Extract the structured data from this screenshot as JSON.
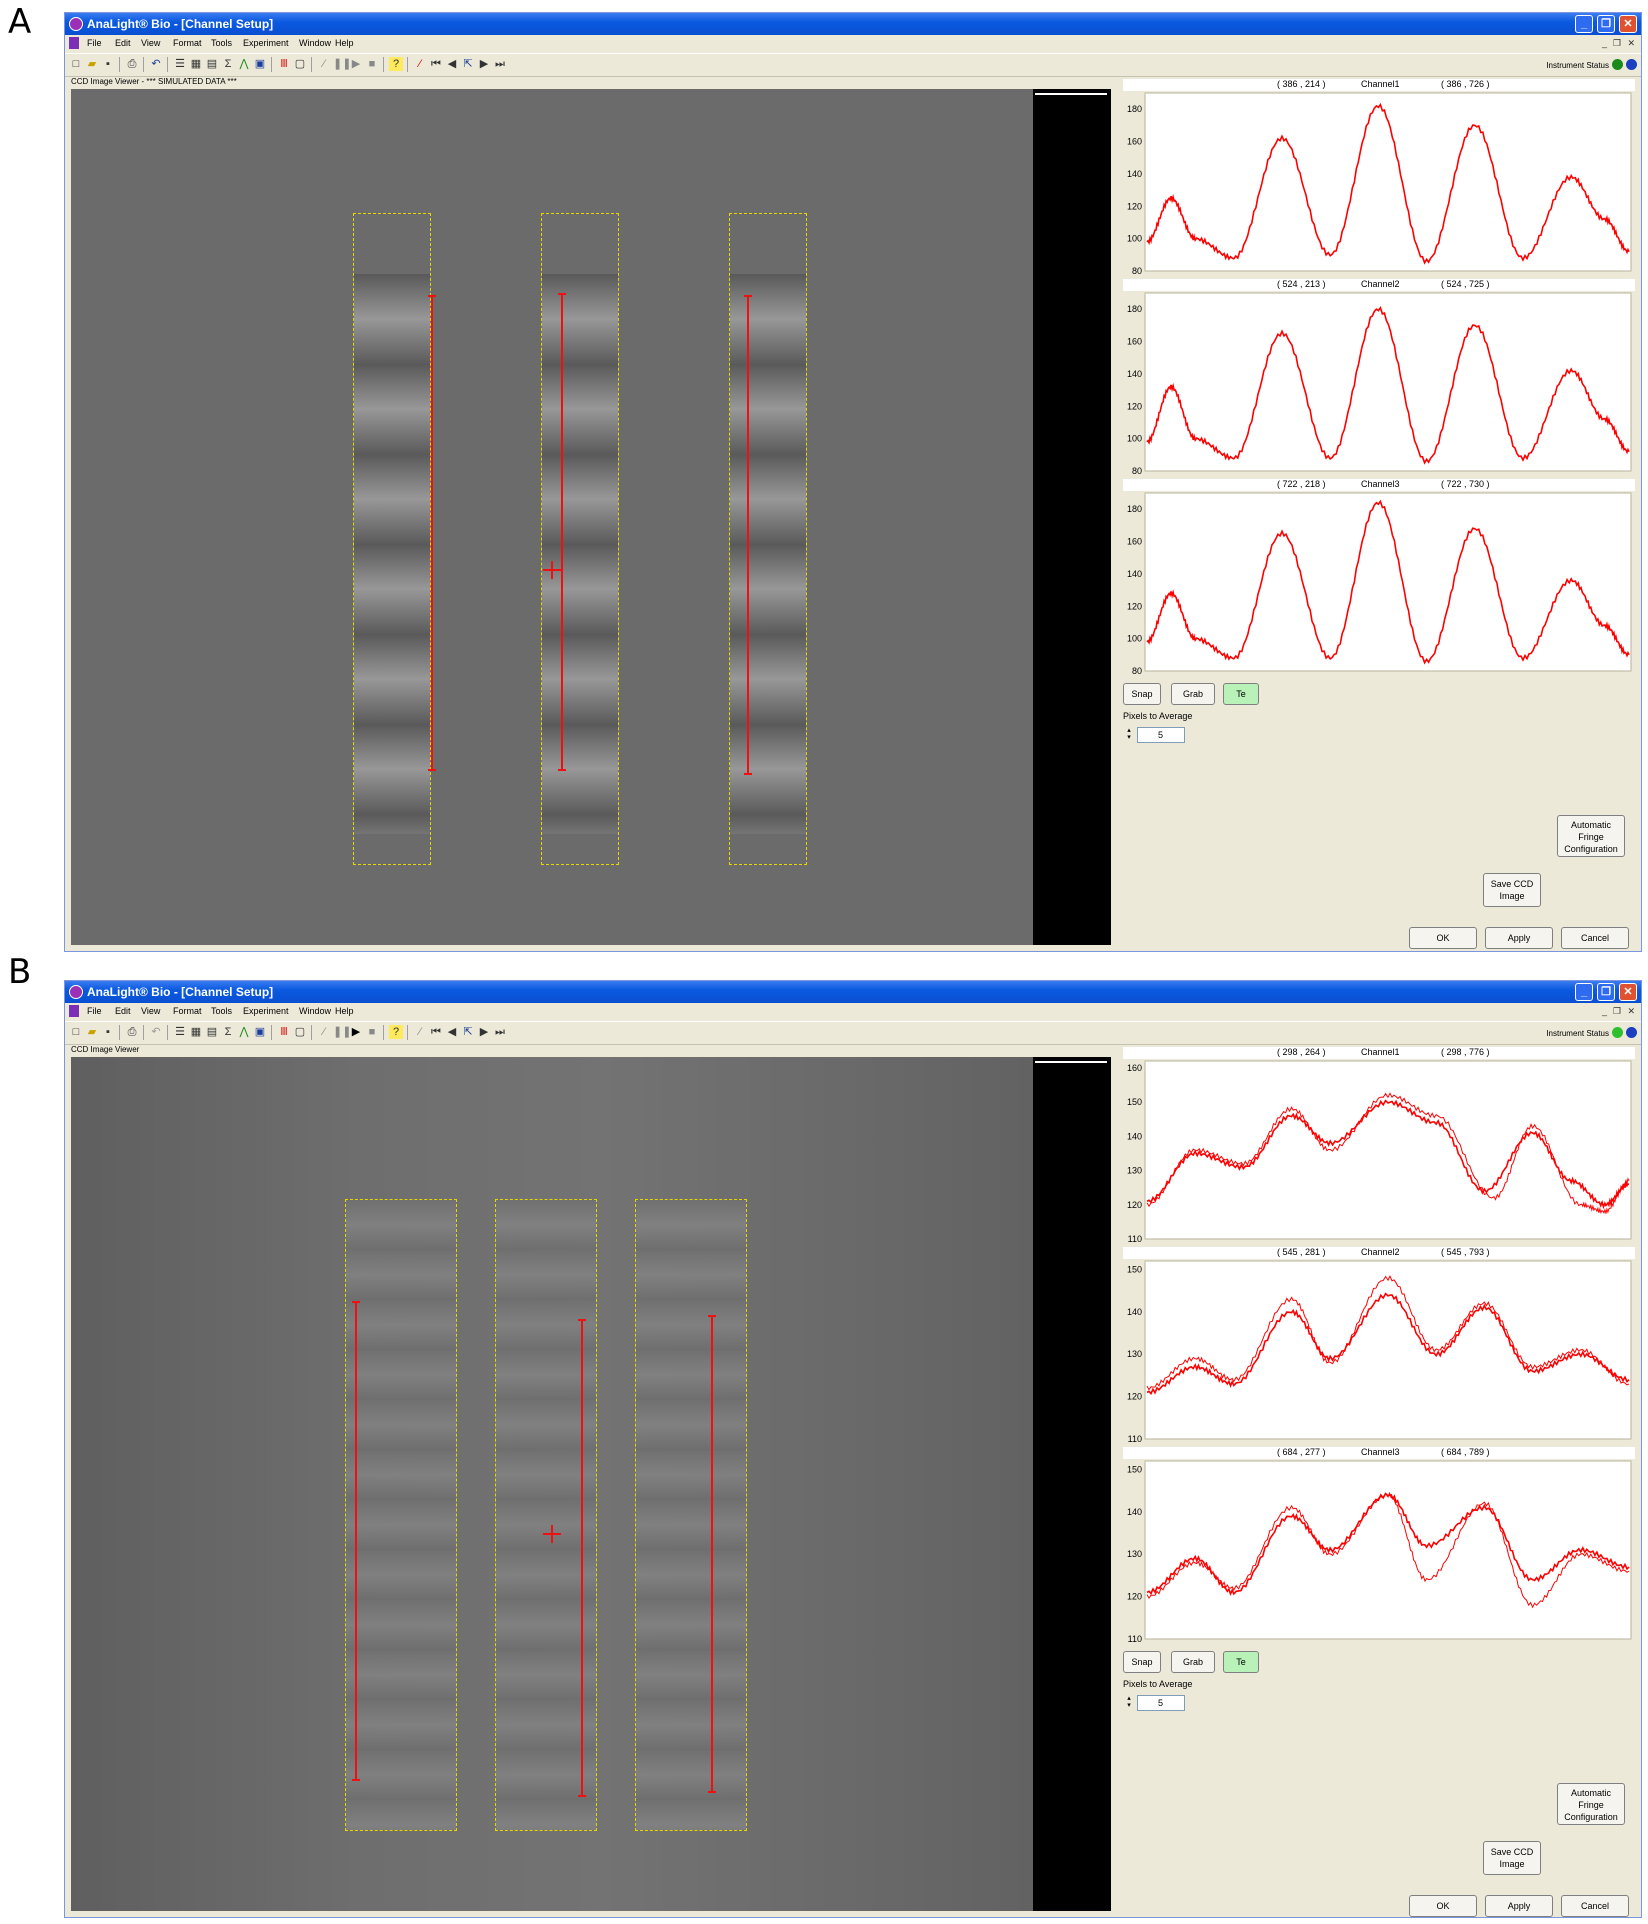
{
  "panels": [
    {
      "letter": "A",
      "window": {
        "title": "AnaLight® Bio - [Channel Setup]",
        "menu": [
          "File",
          "Edit",
          "View",
          "Format",
          "Tools",
          "Experiment",
          "Window",
          "Help"
        ],
        "instrument_status_label": "Instrument Status",
        "viewer_label": "CCD Image Viewer - *** SIMULATED DATA ***"
      },
      "channels": [
        {
          "name": "Channel1",
          "left_coord": "( 386 , 214 )",
          "right_coord": "( 386 , 726 )"
        },
        {
          "name": "Channel2",
          "left_coord": "( 524 , 213 )",
          "right_coord": "( 524 , 725 )"
        },
        {
          "name": "Channel3",
          "left_coord": "( 722 , 218 )",
          "right_coord": "( 722 , 730 )"
        }
      ],
      "buttons": {
        "snap": "Snap",
        "grab": "Grab",
        "te": "Te",
        "auto_fringe": "Automatic Fringe Configuration",
        "save_ccd": "Save CCD Image",
        "ok": "OK",
        "apply": "Apply",
        "cancel": "Cancel"
      },
      "pixels_to_average_label": "Pixels to Average",
      "pixels_to_average_value": "5"
    },
    {
      "letter": "B",
      "window": {
        "title": "AnaLight® Bio - [Channel Setup]",
        "menu": [
          "File",
          "Edit",
          "View",
          "Format",
          "Tools",
          "Experiment",
          "Window",
          "Help"
        ],
        "instrument_status_label": "Instrument Status",
        "viewer_label": "CCD Image Viewer"
      },
      "channels": [
        {
          "name": "Channel1",
          "left_coord": "( 298 , 264 )",
          "right_coord": "( 298 , 776 )"
        },
        {
          "name": "Channel2",
          "left_coord": "( 545 , 281 )",
          "right_coord": "( 545 , 793 )"
        },
        {
          "name": "Channel3",
          "left_coord": "( 684 , 277 )",
          "right_coord": "( 684 , 789 )"
        }
      ],
      "buttons": {
        "snap": "Snap",
        "grab": "Grab",
        "te": "Te",
        "auto_fringe": "Automatic Fringe Configuration",
        "save_ccd": "Save CCD Image",
        "ok": "OK",
        "apply": "Apply",
        "cancel": "Cancel"
      },
      "pixels_to_average_label": "Pixels to Average",
      "pixels_to_average_value": "5"
    }
  ],
  "chart_data": [
    {
      "type": "line",
      "panel": "A",
      "channel": "Channel1",
      "ylim": [
        80,
        190
      ],
      "yticks": [
        80,
        100,
        120,
        140,
        160,
        180
      ],
      "series": [
        {
          "x": [
            0,
            0.05,
            0.1,
            0.18,
            0.28,
            0.38,
            0.48,
            0.58,
            0.68,
            0.78,
            0.88,
            0.95,
            1.0
          ],
          "values": [
            98,
            125,
            100,
            88,
            162,
            90,
            182,
            86,
            170,
            88,
            138,
            112,
            92
          ]
        }
      ]
    },
    {
      "type": "line",
      "panel": "A",
      "channel": "Channel2",
      "ylim": [
        80,
        190
      ],
      "yticks": [
        80,
        100,
        120,
        140,
        160,
        180
      ],
      "series": [
        {
          "x": [
            0,
            0.05,
            0.1,
            0.18,
            0.28,
            0.38,
            0.48,
            0.58,
            0.68,
            0.78,
            0.88,
            0.95,
            1.0
          ],
          "values": [
            98,
            132,
            100,
            88,
            165,
            88,
            180,
            86,
            170,
            88,
            142,
            112,
            92
          ]
        }
      ]
    },
    {
      "type": "line",
      "panel": "A",
      "channel": "Channel3",
      "ylim": [
        80,
        190
      ],
      "yticks": [
        80,
        100,
        120,
        140,
        160,
        180
      ],
      "series": [
        {
          "x": [
            0,
            0.05,
            0.1,
            0.18,
            0.28,
            0.38,
            0.48,
            0.58,
            0.68,
            0.78,
            0.88,
            0.95,
            1.0
          ],
          "values": [
            98,
            128,
            100,
            88,
            165,
            88,
            184,
            86,
            168,
            88,
            136,
            108,
            90
          ]
        }
      ]
    },
    {
      "type": "line",
      "panel": "B",
      "channel": "Channel1",
      "ylim": [
        110,
        162
      ],
      "yticks": [
        110,
        120,
        130,
        140,
        150,
        160
      ],
      "series": [
        {
          "x": [
            0,
            0.1,
            0.2,
            0.3,
            0.38,
            0.5,
            0.6,
            0.7,
            0.8,
            0.88,
            0.95,
            1.0
          ],
          "values": [
            121,
            135,
            131,
            146,
            138,
            150,
            144,
            124,
            141,
            127,
            120,
            126
          ]
        },
        {
          "x": [
            0,
            0.1,
            0.2,
            0.3,
            0.38,
            0.5,
            0.6,
            0.72,
            0.8,
            0.9,
            0.95,
            1.0
          ],
          "values": [
            120,
            136,
            132,
            148,
            136,
            152,
            146,
            122,
            143,
            120,
            118,
            127
          ]
        }
      ]
    },
    {
      "type": "line",
      "panel": "B",
      "channel": "Channel2",
      "ylim": [
        110,
        152
      ],
      "yticks": [
        110,
        120,
        130,
        140,
        150
      ],
      "series": [
        {
          "x": [
            0,
            0.1,
            0.18,
            0.3,
            0.38,
            0.5,
            0.6,
            0.7,
            0.8,
            0.9,
            1.0
          ],
          "values": [
            121,
            127,
            123,
            140,
            129,
            144,
            130,
            141,
            126,
            130,
            124
          ]
        },
        {
          "x": [
            0,
            0.1,
            0.18,
            0.3,
            0.38,
            0.5,
            0.6,
            0.7,
            0.8,
            0.9,
            1.0
          ],
          "values": [
            122,
            129,
            124,
            143,
            128,
            148,
            131,
            142,
            127,
            131,
            123
          ]
        }
      ]
    },
    {
      "type": "line",
      "panel": "B",
      "channel": "Channel3",
      "ylim": [
        110,
        152
      ],
      "yticks": [
        110,
        120,
        130,
        140,
        150
      ],
      "series": [
        {
          "x": [
            0,
            0.1,
            0.18,
            0.3,
            0.38,
            0.5,
            0.58,
            0.7,
            0.8,
            0.9,
            1.0
          ],
          "values": [
            121,
            129,
            121,
            139,
            131,
            144,
            132,
            141,
            124,
            131,
            127
          ]
        },
        {
          "x": [
            0,
            0.1,
            0.18,
            0.3,
            0.38,
            0.5,
            0.58,
            0.7,
            0.8,
            0.9,
            1.0
          ],
          "values": [
            120,
            128,
            122,
            141,
            130,
            144,
            124,
            142,
            118,
            130,
            126
          ]
        }
      ]
    }
  ]
}
